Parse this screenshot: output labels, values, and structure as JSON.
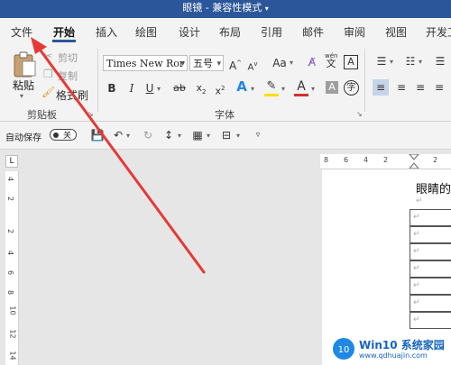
{
  "window": {
    "title": "眼镜 - 兼容性模式"
  },
  "tabs": [
    "文件",
    "开始",
    "插入",
    "绘图",
    "设计",
    "布局",
    "引用",
    "邮件",
    "审阅",
    "视图",
    "开发工"
  ],
  "ribbon": {
    "paste_label": "粘贴",
    "cut_label": "剪切",
    "copy_label": "复制",
    "format_painter_label": "格式刷",
    "clipboard_group": "剪贴板",
    "font_group": "字体",
    "font_name": "Times New Ror",
    "font_size": "五号",
    "pinyin_label": "wén",
    "aa_label": "Aa"
  },
  "qat": {
    "autosave_label": "自动保存",
    "toggle_state": "关"
  },
  "ruler": {
    "h_ticks": [
      "8",
      "6",
      "4",
      "2",
      "2"
    ],
    "v_ticks": [
      "4",
      "2",
      "2",
      "4",
      "6",
      "8",
      "10",
      "12",
      "14"
    ]
  },
  "document": {
    "title_fragment": "眼睛的",
    "para_mark": "↵"
  },
  "watermark": {
    "brand": "Win10 系统家园",
    "url": "www.qdhuajin.com"
  },
  "colors": {
    "accent": "#2b579a",
    "arrow": "#e53935",
    "highlight": "#f6e000",
    "font_color": "#d32f2f"
  }
}
